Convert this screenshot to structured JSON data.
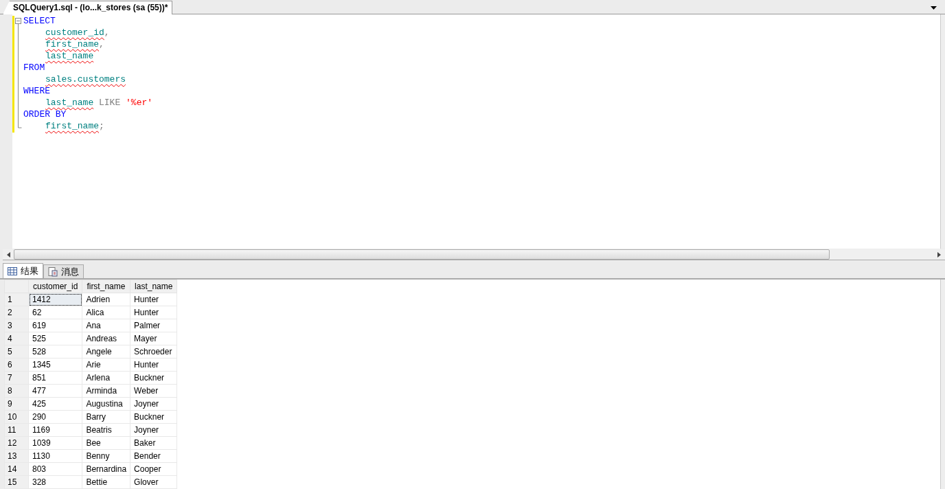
{
  "editor_tab": {
    "title": "SQLQuery1.sql - (lo...k_stores (sa (55))*"
  },
  "code": [
    {
      "indented": false,
      "tokens": [
        {
          "kind": "keyword",
          "text": "SELECT"
        }
      ]
    },
    {
      "indented": true,
      "tokens": [
        {
          "kind": "ident",
          "text": "customer_id"
        },
        {
          "kind": "punct",
          "text": ","
        }
      ]
    },
    {
      "indented": true,
      "tokens": [
        {
          "kind": "ident",
          "text": "first_name"
        },
        {
          "kind": "punct",
          "text": ","
        }
      ]
    },
    {
      "indented": true,
      "tokens": [
        {
          "kind": "ident",
          "text": "last_name"
        }
      ]
    },
    {
      "indented": false,
      "tokens": [
        {
          "kind": "keyword",
          "text": "FROM"
        }
      ]
    },
    {
      "indented": true,
      "tokens": [
        {
          "kind": "ident",
          "text": "sales.customers"
        }
      ]
    },
    {
      "indented": false,
      "tokens": [
        {
          "kind": "keyword",
          "text": "WHERE"
        }
      ]
    },
    {
      "indented": true,
      "tokens": [
        {
          "kind": "ident",
          "text": "last_name"
        },
        {
          "kind": "operator",
          "text": " LIKE "
        },
        {
          "kind": "string",
          "text": "'%er'"
        }
      ]
    },
    {
      "indented": false,
      "tokens": [
        {
          "kind": "keyword",
          "text": "ORDER BY"
        }
      ]
    },
    {
      "indented": true,
      "tokens": [
        {
          "kind": "ident",
          "text": "first_name"
        },
        {
          "kind": "punct",
          "text": ";"
        }
      ]
    }
  ],
  "result_tabs": [
    {
      "label": "结果",
      "kind": "grid",
      "selected": true
    },
    {
      "label": "消息",
      "kind": "messages",
      "selected": false
    }
  ],
  "table": {
    "columns": [
      "customer_id",
      "first_name",
      "last_name"
    ],
    "rows": [
      {
        "number": "1",
        "focused": true,
        "cells": [
          "1412",
          "Adrien",
          "Hunter"
        ]
      },
      {
        "number": "2",
        "focused": false,
        "cells": [
          "62",
          "Alica",
          "Hunter"
        ]
      },
      {
        "number": "3",
        "focused": false,
        "cells": [
          "619",
          "Ana",
          "Palmer"
        ]
      },
      {
        "number": "4",
        "focused": false,
        "cells": [
          "525",
          "Andreas",
          "Mayer"
        ]
      },
      {
        "number": "5",
        "focused": false,
        "cells": [
          "528",
          "Angele",
          "Schroeder"
        ]
      },
      {
        "number": "6",
        "focused": false,
        "cells": [
          "1345",
          "Arie",
          "Hunter"
        ]
      },
      {
        "number": "7",
        "focused": false,
        "cells": [
          "851",
          "Arlena",
          "Buckner"
        ]
      },
      {
        "number": "8",
        "focused": false,
        "cells": [
          "477",
          "Arminda",
          "Weber"
        ]
      },
      {
        "number": "9",
        "focused": false,
        "cells": [
          "425",
          "Augustina",
          "Joyner"
        ]
      },
      {
        "number": "10",
        "focused": false,
        "cells": [
          "290",
          "Barry",
          "Buckner"
        ]
      },
      {
        "number": "11",
        "focused": false,
        "cells": [
          "1169",
          "Beatris",
          "Joyner"
        ]
      },
      {
        "number": "12",
        "focused": false,
        "cells": [
          "1039",
          "Bee",
          "Baker"
        ]
      },
      {
        "number": "13",
        "focused": false,
        "cells": [
          "1130",
          "Benny",
          "Bender"
        ]
      },
      {
        "number": "14",
        "focused": false,
        "cells": [
          "803",
          "Bernardina",
          "Cooper"
        ]
      },
      {
        "number": "15",
        "focused": false,
        "cells": [
          "328",
          "Bettie",
          "Glover"
        ]
      }
    ]
  }
}
